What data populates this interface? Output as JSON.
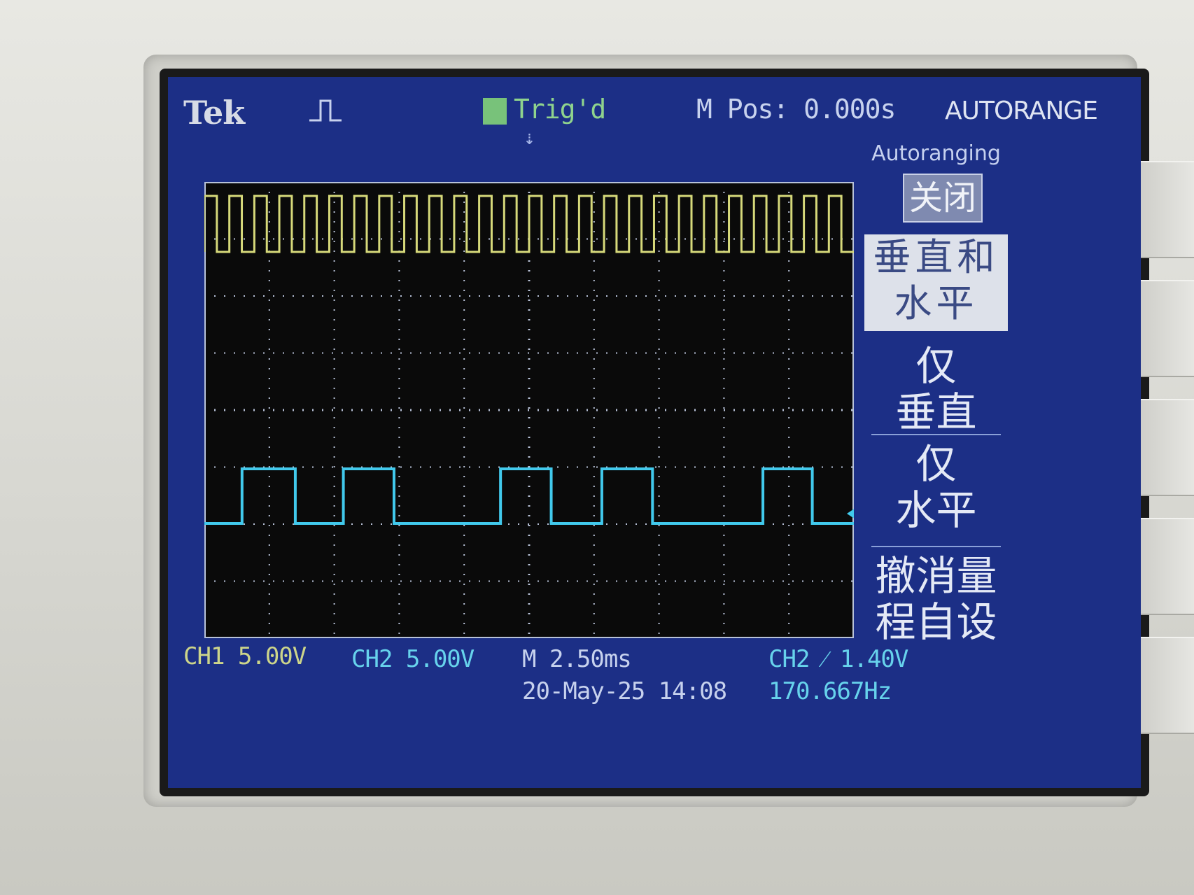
{
  "header": {
    "brand": "Tek",
    "trigger_status": "Trig'd",
    "main_position": "M Pos: 0.000s",
    "mode": "AUTORANGE"
  },
  "menu": {
    "title": "Autoranging",
    "off_option": "关闭",
    "both_option_line1": "垂直和",
    "both_option_line2": "水平",
    "vertical_only_line1": "仅",
    "vertical_only_line2": "垂直",
    "horizontal_only_line1": "仅",
    "horizontal_only_line2": "水平",
    "undo_line1": "撤消量",
    "undo_line2": "程自设"
  },
  "status": {
    "ch1_scale": "CH1  5.00V",
    "ch2_scale": "CH2  5.00V",
    "timebase": "M 2.50ms",
    "datetime": "20-May-25 14:08",
    "trigger": "CH2 ⁄ 1.40V",
    "frequency": "170.667Hz"
  },
  "markers": {
    "ch1": "1",
    "ch2": "2"
  },
  "colors": {
    "ch1": "#d6d97a",
    "ch2": "#41c9ec",
    "screen_bg": "#000000",
    "graticule": "#b8c2d8",
    "ui_bg": "#1c2f86"
  },
  "waveforms": {
    "ch1_cycles": 26,
    "ch2_edges": [
      0.058,
      0.14,
      0.214,
      0.292,
      0.456,
      0.534,
      0.612,
      0.69,
      0.86,
      0.936
    ]
  },
  "icons": {
    "trigger_edge": "rising-edge-icon",
    "trigger_ready": "trig-box-icon",
    "trigger_position": "trigger-arrow-icon"
  }
}
